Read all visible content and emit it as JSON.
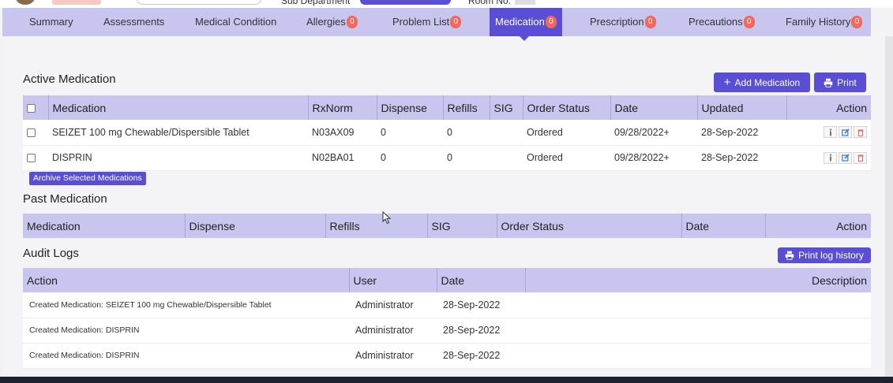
{
  "tabs": [
    {
      "label": "Summary",
      "badge": null
    },
    {
      "label": "Assessments",
      "badge": null
    },
    {
      "label": "Medical Condition",
      "badge": null
    },
    {
      "label": "Allergies",
      "badge": "0"
    },
    {
      "label": "Problem List",
      "badge": "0"
    },
    {
      "label": "Medication",
      "badge": "0",
      "active": true
    },
    {
      "label": "Prescription",
      "badge": "0"
    },
    {
      "label": "Precautions",
      "badge": "0"
    },
    {
      "label": "Family History",
      "badge": "0"
    }
  ],
  "header_partial": {
    "dept_label": "Sub Department",
    "room_label": "Room No."
  },
  "active_medication": {
    "title": "Active Medication",
    "add_button": "Add Medication",
    "print_button": "Print",
    "archive_button": "Archive Selected Medications",
    "columns": [
      "Medication",
      "RxNorm",
      "Dispense",
      "Refills",
      "SIG",
      "Order Status",
      "Date",
      "Updated",
      "Action"
    ],
    "rows": [
      {
        "medication": "SEIZET 100 mg Chewable/Dispersible Tablet",
        "rxnorm": "N03AX09",
        "dispense": "0",
        "refills": "0",
        "sig": "",
        "order_status": "Ordered",
        "date": "09/28/2022+",
        "updated": "28-Sep-2022"
      },
      {
        "medication": "DISPRIN",
        "rxnorm": "N02BA01",
        "dispense": "0",
        "refills": "0",
        "sig": "",
        "order_status": "Ordered",
        "date": "09/28/2022+",
        "updated": "28-Sep-2022"
      }
    ]
  },
  "past_medication": {
    "title": "Past Medication",
    "columns": [
      "Medication",
      "Dispense",
      "Refills",
      "SIG",
      "Order Status",
      "Date",
      "Action"
    ]
  },
  "audit_logs": {
    "title": "Audit Logs",
    "print_button": "Print log history",
    "columns": [
      "Action",
      "User",
      "Date",
      "Description"
    ],
    "rows": [
      {
        "action": "Created Medication: SEIZET 100 mg Chewable/Dispersible Tablet",
        "user": "Administrator",
        "date": "28-Sep-2022",
        "description": ""
      },
      {
        "action": "Created Medication: DISPRIN",
        "user": "Administrator",
        "date": "28-Sep-2022",
        "description": ""
      },
      {
        "action": "Created Medication: DISPRIN",
        "user": "Administrator",
        "date": "28-Sep-2022",
        "description": ""
      }
    ]
  },
  "colors": {
    "accent": "#5a4fd4",
    "tab_bar": "#c8c5ee",
    "badge": "#f0695c"
  }
}
